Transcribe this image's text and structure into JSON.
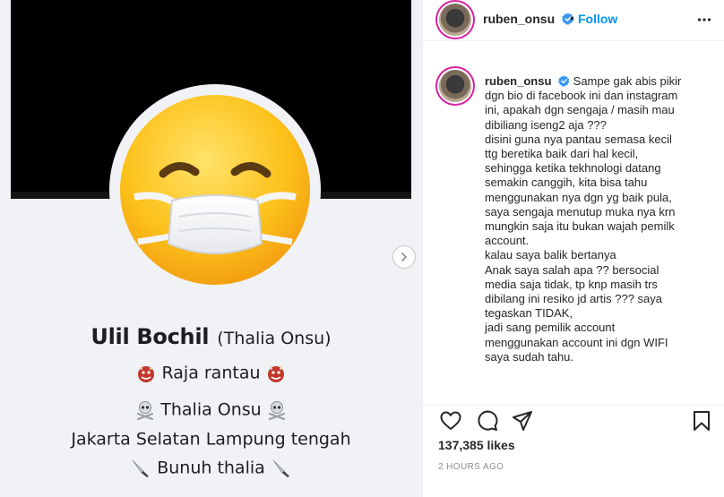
{
  "post_image": {
    "name": "Ulil Bochil",
    "name_alt": "(Thalia Onsu)",
    "bio": [
      {
        "icon": "ogre-icon",
        "text": "Raja  rantau"
      },
      {
        "icon": "skull-crossbones-icon",
        "text": "Thalia Onsu"
      },
      {
        "icon": "",
        "text": "Jakarta Selatan Lampung tengah"
      },
      {
        "icon": "knife-icon",
        "text": "Bunuh thalia"
      }
    ],
    "emoji_icon": "mask-face-icon"
  },
  "header": {
    "username": "ruben_onsu",
    "separator": "•",
    "follow_label": "Follow"
  },
  "caption": {
    "username": "ruben_onsu",
    "first_line": "Sampe gak abis pikir",
    "lines": [
      "dgn bio di facebook ini dan instagram",
      "ini, apakah dgn sengaja / masih mau",
      "dibiliang iseng2 aja ???",
      "disini guna nya pantau semasa kecil",
      "ttg beretika baik dari hal kecil,",
      "sehingga ketika tekhnologi datang",
      "semakin canggih, kita bisa tahu",
      "menggunakan nya dgn yg baik pula,",
      "saya sengaja menutup muka nya krn",
      "mungkin saja itu bukan wajah pemilk",
      "account.",
      "kalau saya balik bertanya",
      "Anak saya salah apa ?? bersocial",
      "media saja tidak, tp knp masih trs",
      "dibilang ini resiko jd artis ??? saya",
      "tegaskan TIDAK,",
      "jadi sang pemilik account",
      "menggunakan account ini dgn WIFI",
      "saya sudah tahu."
    ]
  },
  "stats": {
    "likes": "137,385 likes",
    "timestamp": "2 HOURS AGO"
  },
  "colors": {
    "follow_blue": "#0095f6",
    "verified_blue": "#3897f0",
    "story_ring": "#d6249f",
    "muted_text": "#8e8e8e"
  }
}
